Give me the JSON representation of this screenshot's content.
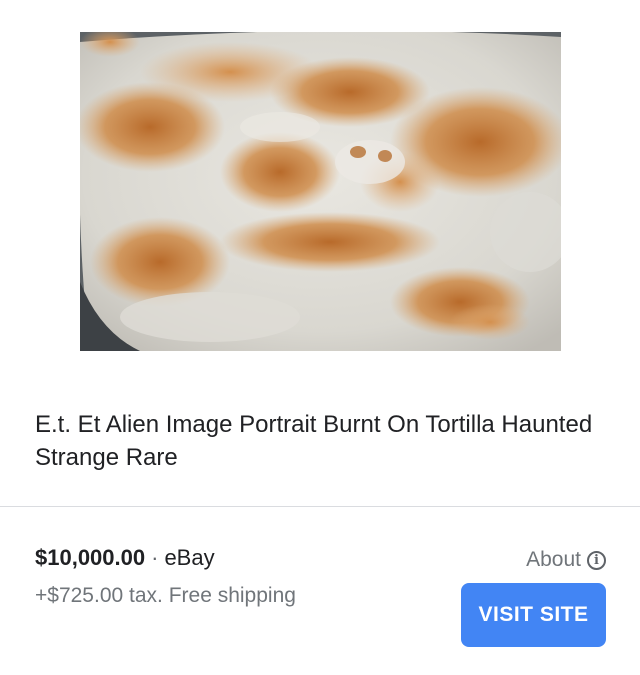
{
  "product": {
    "image_alt": "Tortilla with burn marks resembling an alien face",
    "title": "E.t. Et Alien Image Portrait Burnt On Tortilla Haunted Strange Rare",
    "price": "$10,000.00",
    "separator": "·",
    "merchant": "eBay",
    "shipping": "+$725.00 tax. Free shipping"
  },
  "actions": {
    "about_label": "About",
    "about_icon": "info-icon",
    "visit_label": "VISIT SITE"
  },
  "colors": {
    "accent": "#4285f4",
    "divider": "#dadce0",
    "secondary_text": "#70757a"
  }
}
